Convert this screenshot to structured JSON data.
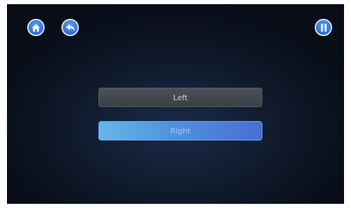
{
  "toolbar": {
    "home_icon": "home-icon",
    "back_icon": "back-arrow-icon",
    "pause_icon": "pause-icon"
  },
  "options": [
    {
      "label": "Left",
      "selected": false
    },
    {
      "label": "Right",
      "selected": true
    }
  ],
  "colors": {
    "background": "#0e1828",
    "button_blue": "#2f6fd0",
    "selected_option": "#4f92dd",
    "unselected_option": "#42484e"
  }
}
